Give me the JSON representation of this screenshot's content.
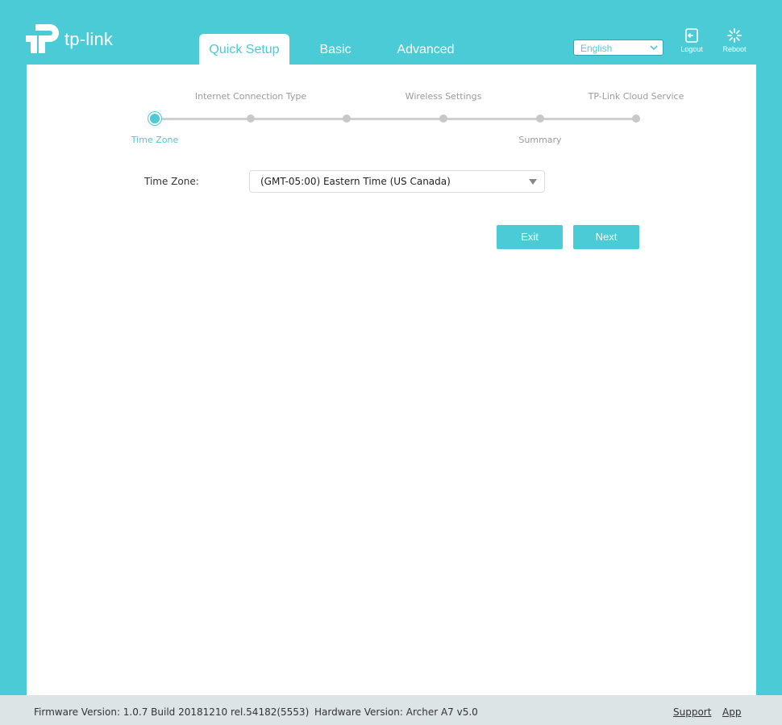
{
  "brand": {
    "logo_text": "tp-link"
  },
  "nav": {
    "tabs": [
      {
        "label": "Quick Setup",
        "active": true
      },
      {
        "label": "Basic",
        "active": false
      },
      {
        "label": "Advanced",
        "active": false
      }
    ]
  },
  "header": {
    "language": "English",
    "logout_label": "Logout",
    "reboot_label": "Reboot"
  },
  "wizard": {
    "steps_top": [
      "Internet Connection Type",
      "Wireless Settings",
      "TP-Link Cloud Service"
    ],
    "steps_bottom": [
      "Time Zone",
      "Summary"
    ],
    "current_step": "Time Zone"
  },
  "form": {
    "timezone_label": "Time Zone:",
    "timezone_value": "(GMT-05:00) Eastern Time (US Canada)"
  },
  "actions": {
    "exit_label": "Exit",
    "next_label": "Next"
  },
  "footer": {
    "firmware": "Firmware Version: 1.0.7 Build 20181210 rel.54182(5553)",
    "hardware": "Hardware Version: Archer A7 v5.0",
    "support_label": "Support",
    "app_label": "App"
  },
  "colors": {
    "accent": "#4acbd6",
    "panel": "#ffffff",
    "footer": "#dde4e6"
  }
}
